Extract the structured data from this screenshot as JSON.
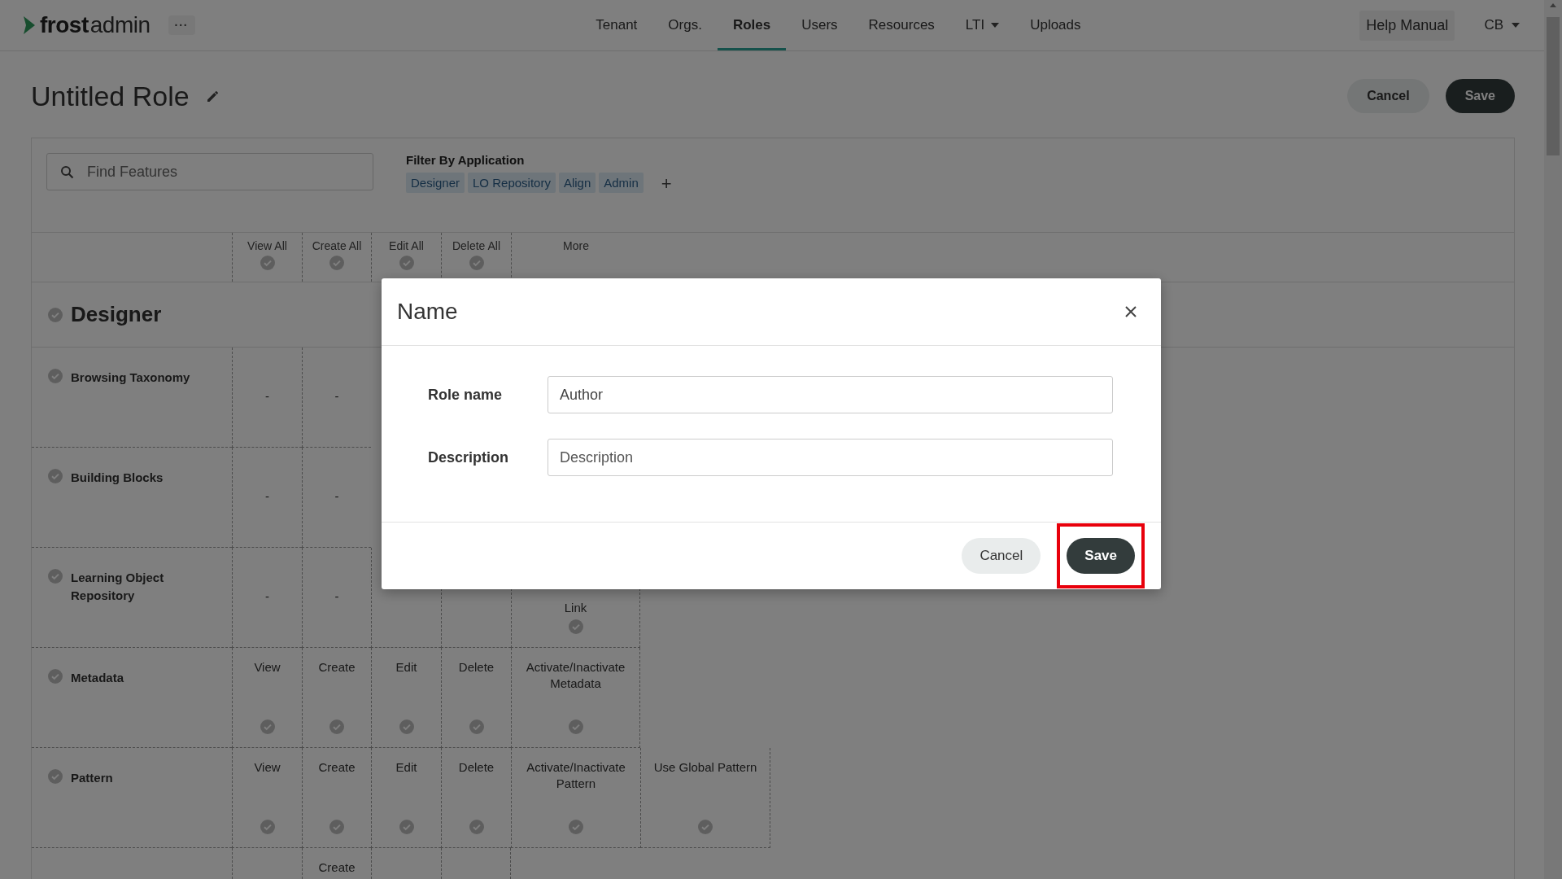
{
  "brand": {
    "name": "frost",
    "suffix": "admin",
    "more": "···"
  },
  "nav": [
    {
      "label": "Tenant",
      "selected": false
    },
    {
      "label": "Orgs.",
      "selected": false
    },
    {
      "label": "Roles",
      "selected": true
    },
    {
      "label": "Users",
      "selected": false
    },
    {
      "label": "Resources",
      "selected": false
    },
    {
      "label": "LTI",
      "selected": false,
      "dropdown": true
    },
    {
      "label": "Uploads",
      "selected": false
    }
  ],
  "help": "Help Manual",
  "user": "CB",
  "page": {
    "title": "Untitled Role",
    "buttons": [
      {
        "label": "Cancel",
        "kind": "secondary"
      },
      {
        "label": "Save",
        "kind": "primary"
      }
    ]
  },
  "search": {
    "placeholder": "Find Features"
  },
  "filter": {
    "title": "Filter By Application",
    "tags": [
      "Designer",
      "LO Repository",
      "Align",
      "Admin"
    ],
    "add": "+"
  },
  "columns": [
    {
      "label": "View All",
      "check": true
    },
    {
      "label": "Create All",
      "check": true
    },
    {
      "label": "Edit All",
      "check": true
    },
    {
      "label": "Delete All",
      "check": true
    },
    {
      "label": "More",
      "check": false
    }
  ],
  "section": "Designer",
  "rows": [
    {
      "name": "Browsing Taxonomy",
      "cells": [
        {
          "kind": "dash",
          "label": "-"
        },
        {
          "kind": "dash",
          "label": "-"
        }
      ]
    },
    {
      "name": "Building Blocks",
      "cells": [
        {
          "kind": "dash",
          "label": "-"
        },
        {
          "kind": "dash",
          "label": "-"
        }
      ]
    },
    {
      "name": "Learning Object Repository",
      "cells": [
        {
          "kind": "dash",
          "label": "-"
        },
        {
          "kind": "dash",
          "label": "-"
        },
        {
          "kind": "blank"
        },
        {
          "kind": "blank"
        }
      ],
      "extra": [
        {
          "kind": "tail",
          "label": "Link"
        }
      ]
    },
    {
      "name": "Metadata",
      "cells": [
        {
          "kind": "perm",
          "label": "View"
        },
        {
          "kind": "perm",
          "label": "Create"
        },
        {
          "kind": "perm",
          "label": "Edit"
        },
        {
          "kind": "perm",
          "label": "Delete"
        }
      ],
      "extra": [
        {
          "kind": "perm",
          "label": "Activate/Inactivate Metadata"
        }
      ]
    },
    {
      "name": "Pattern",
      "cells": [
        {
          "kind": "perm",
          "label": "View"
        },
        {
          "kind": "perm",
          "label": "Create"
        },
        {
          "kind": "perm",
          "label": "Edit"
        },
        {
          "kind": "perm",
          "label": "Delete"
        }
      ],
      "extra": [
        {
          "kind": "perm",
          "label": "Activate/Inactivate Pattern"
        },
        {
          "kind": "perm",
          "label": "Use Global Pattern"
        }
      ]
    },
    {
      "cells": [
        {
          "kind": "blank"
        },
        {
          "kind": "perm",
          "label": "Create"
        },
        {
          "kind": "blank"
        },
        {
          "kind": "blank"
        }
      ]
    }
  ],
  "modal": {
    "title": "Name",
    "fields": [
      {
        "label": "Role name",
        "value": "Author"
      },
      {
        "label": "Description",
        "placeholder": "Description"
      }
    ],
    "buttons": [
      {
        "label": "Cancel",
        "kind": "secondary",
        "highlighted": false
      },
      {
        "label": "Save",
        "kind": "primary",
        "highlighted": true
      }
    ]
  }
}
